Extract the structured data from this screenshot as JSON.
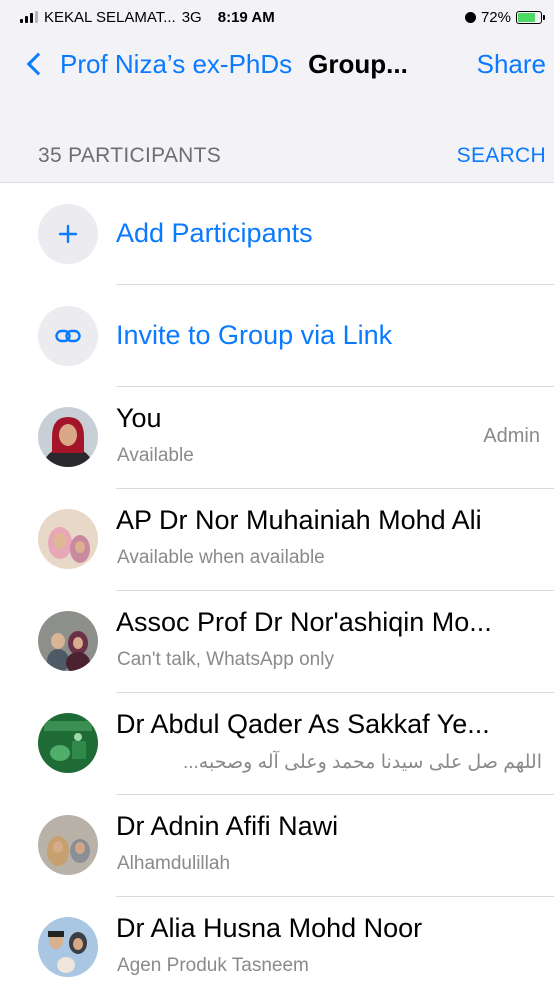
{
  "status_bar": {
    "carrier": "KEKAL SELAMAT...",
    "network": "3G",
    "time": "8:19 AM",
    "battery": "72%"
  },
  "nav": {
    "back_label": "Prof Niza’s ex-PhDs",
    "title": "Group...",
    "share_label": "Share"
  },
  "section": {
    "count_label": "35 PARTICIPANTS",
    "search_label": "SEARCH"
  },
  "actions": [
    {
      "label": "Add Participants",
      "icon": "plus-icon"
    },
    {
      "label": "Invite to Group via Link",
      "icon": "link-icon"
    }
  ],
  "participants": [
    {
      "name": "You",
      "status": "Available",
      "role": "Admin"
    },
    {
      "name": "AP Dr Nor Muhainiah Mohd Ali",
      "status": "Available when available",
      "role": ""
    },
    {
      "name": "Assoc Prof Dr Nor'ashiqin Mo...",
      "status": "Can't talk, WhatsApp only",
      "role": ""
    },
    {
      "name": "Dr Abdul Qader As Sakkaf Ye...",
      "status": "اللهم صل على سيدنا محمد وعلى آله وصحبه...",
      "role": ""
    },
    {
      "name": "Dr Adnin Afifi Nawi",
      "status": "Alhamdulillah",
      "role": ""
    },
    {
      "name": "Dr Alia Husna Mohd Noor",
      "status": "Agen Produk Tasneem",
      "role": ""
    }
  ],
  "colors": {
    "accent": "#0a7aff",
    "grouped_background": "#f2f2f7",
    "secondary_text": "#8a8a8e"
  }
}
